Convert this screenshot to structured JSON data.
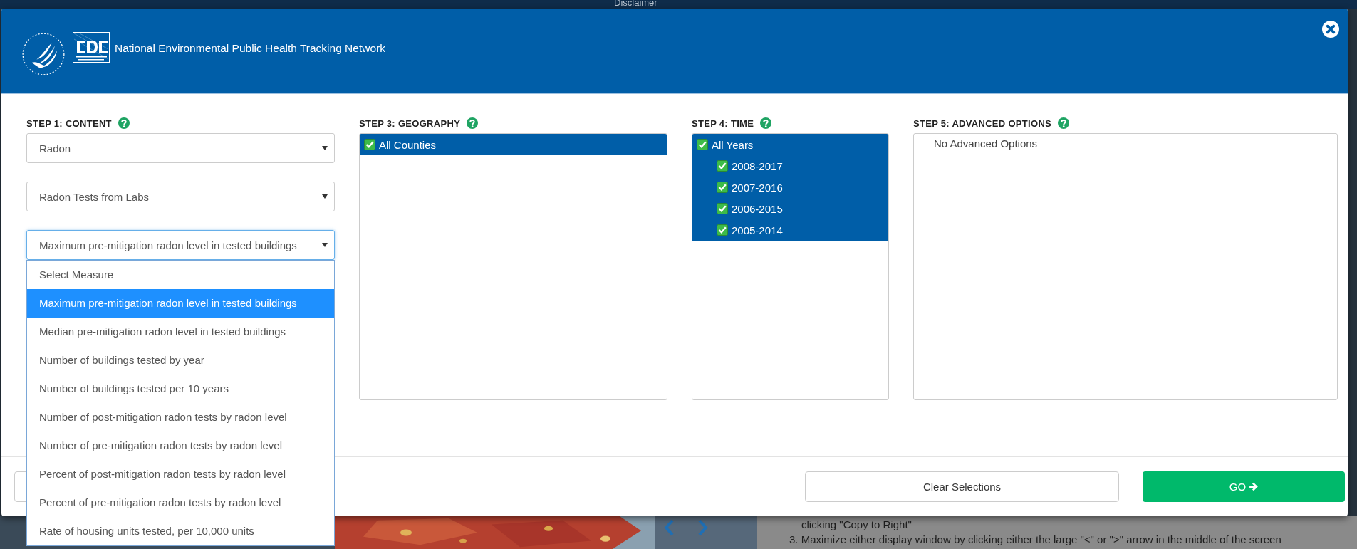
{
  "background": {
    "top_link": "Disclaimer",
    "map": {
      "kind": "picture"
    },
    "instructions": [
      "clicking \"Copy to Right\"",
      "3. Maximize either display window by clicking either the large \"<\" or \">\" arrow in the middle of the screen"
    ]
  },
  "modal": {
    "title": "National Environmental Public Health Tracking Network",
    "steps": [
      {
        "kind": "selects",
        "heading": "STEP 1: CONTENT",
        "selects": [
          {
            "value": "Radon",
            "focused": false
          },
          {
            "value": "Radon Tests from Labs",
            "focused": false
          },
          {
            "value": "Maximum pre-mitigation radon level in tested buildings",
            "focused": true
          }
        ],
        "dropdown": {
          "options": [
            {
              "label": "Select Measure",
              "selected": false
            },
            {
              "label": "Maximum pre-mitigation radon level in tested buildings",
              "selected": true
            },
            {
              "label": "Median pre-mitigation radon level in tested buildings",
              "selected": false
            },
            {
              "label": "Number of buildings tested by year",
              "selected": false
            },
            {
              "label": "Number of buildings tested per 10 years",
              "selected": false
            },
            {
              "label": "Number of post-mitigation radon tests by radon level",
              "selected": false
            },
            {
              "label": "Number of pre-mitigation radon tests by radon level",
              "selected": false
            },
            {
              "label": "Percent of post-mitigation radon tests by radon level",
              "selected": false
            },
            {
              "label": "Percent of pre-mitigation radon tests by radon level",
              "selected": false
            },
            {
              "label": "Rate of housing units tested, per 10,000 units",
              "selected": false
            }
          ]
        }
      },
      {
        "kind": "tree",
        "heading": "STEP 3: GEOGRAPHY",
        "items": [
          {
            "label": "All Counties",
            "checked": true,
            "selected": true
          }
        ]
      },
      {
        "kind": "tree",
        "heading": "STEP 4: TIME",
        "items": [
          {
            "label": "All Years",
            "checked": true,
            "selected": true,
            "children": [
              {
                "label": "2008-2017",
                "checked": true,
                "selected": true
              },
              {
                "label": "2007-2016",
                "checked": true,
                "selected": true
              },
              {
                "label": "2006-2015",
                "checked": true,
                "selected": true
              },
              {
                "label": "2005-2014",
                "checked": true,
                "selected": true
              }
            ]
          }
        ]
      },
      {
        "kind": "message",
        "heading": "STEP 5: ADVANCED OPTIONS",
        "message": "No Advanced Options"
      }
    ],
    "buttons": [
      {
        "kind": "outline"
      },
      {
        "kind": "secondary",
        "label": "Clear Selections"
      },
      {
        "kind": "primary",
        "label": "GO"
      }
    ]
  }
}
